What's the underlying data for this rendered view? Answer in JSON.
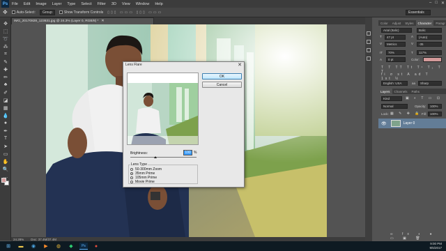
{
  "menubar": {
    "logo": "Ps",
    "items": [
      "File",
      "Edit",
      "Image",
      "Layer",
      "Type",
      "Select",
      "Filter",
      "3D",
      "View",
      "Window",
      "Help"
    ],
    "window_controls": [
      "–",
      "□",
      "✕"
    ]
  },
  "options_bar": {
    "auto_select_label": "Auto-Select:",
    "auto_select_value": "Group",
    "show_transform_label": "Show Transform Controls",
    "workspace": "Essentials"
  },
  "document": {
    "tab_title": "IMG_20170828_123631.jpg @ 24.3% (Layer 0, RGB/8) *",
    "zoom": "24.28%",
    "doc_info": "Doc: 37.4M/37.4M"
  },
  "dialog": {
    "title": "Lens Flare",
    "close_glyph": "✕",
    "ok_label": "OK",
    "cancel_label": "Cancel",
    "brightness_label": "Brightness:",
    "brightness_value": "100",
    "brightness_unit": "%",
    "lens_type_label": "Lens Type",
    "lens_types": [
      "50-300mm Zoom",
      "35mm Prime",
      "105mm Prime",
      "Movie Prime"
    ],
    "selected_lens": "35mm Prime"
  },
  "panels": {
    "character_tabs": [
      "Color",
      "Adjust",
      "Styles",
      "Character",
      "Paragr"
    ],
    "font_family": "Arial (Italic)",
    "font_style": "Bolic",
    "font_size": "47 pt",
    "leading": "(Auto)",
    "kerning": "Metrics",
    "tracking": "-35",
    "vertical_scale": "70%",
    "horizontal_scale": "117%",
    "baseline": "0 pt",
    "color_label": "Color:",
    "language": "English: USA",
    "anti_alias": "Sharp",
    "layers_tabs": [
      "Layers",
      "Channels",
      "Paths"
    ],
    "kind_label": "Kind",
    "blend_mode": "Normal",
    "opacity_label": "Opacity:",
    "opacity_value": "100%",
    "lock_label": "Lock:",
    "fill_label": "Fill:",
    "fill_value": "100%",
    "layer_name": "Layer 0"
  },
  "taskbar": {
    "time": "9:00 PM",
    "date": "9/6/2017"
  },
  "colors": {
    "foreground": "#d49a9a",
    "background": "#ffffff",
    "accent": "#3399ff"
  }
}
